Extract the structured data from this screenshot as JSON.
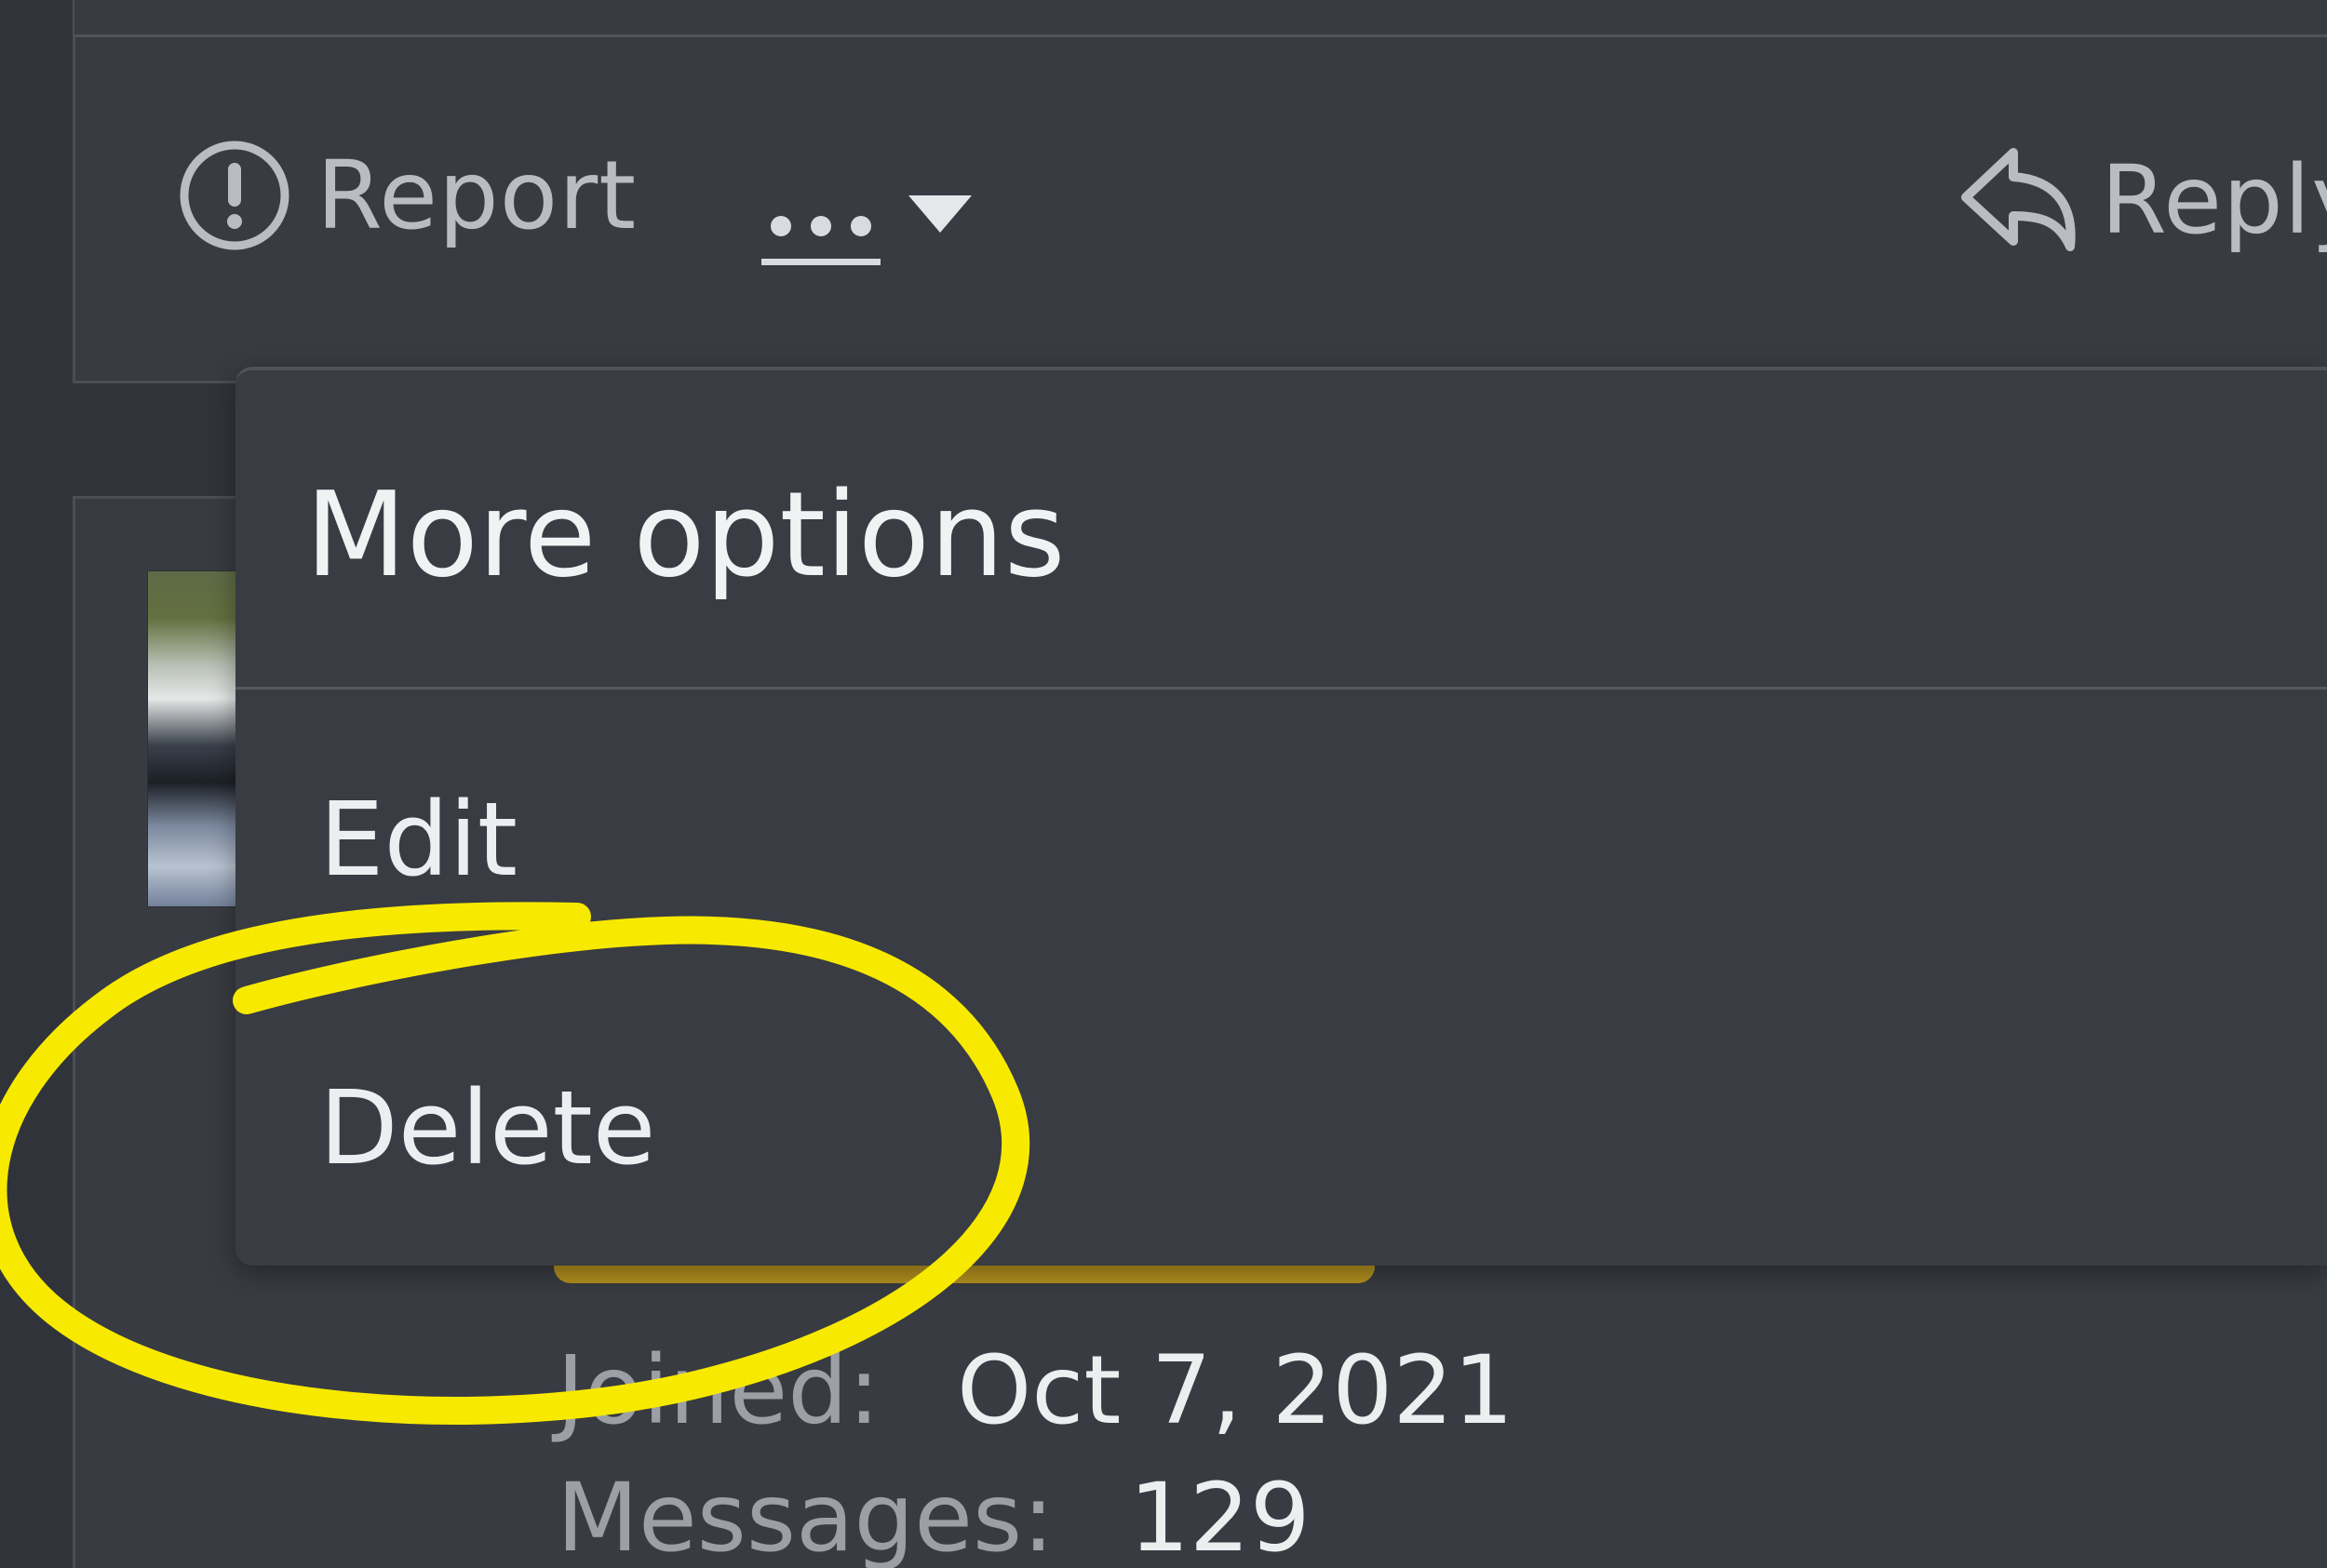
{
  "post_footer": {
    "report_label": "Report",
    "reply_label": "Reply",
    "icons": {
      "report": "exclamation-circle-icon",
      "more": "ellipsis-icon",
      "caret": "caret-down-icon",
      "reply": "reply-arrow-icon"
    }
  },
  "menu": {
    "title": "More options",
    "items": [
      {
        "label": "Edit"
      },
      {
        "label": "Delete"
      }
    ]
  },
  "user_stats": {
    "joined_label": "Joined:",
    "joined_value": "Oct 7, 2021",
    "messages_label": "Messages:",
    "messages_value": "129"
  },
  "colors": {
    "background": "#30343a",
    "panel": "#383b41",
    "menu": "#393c42",
    "highlight": "#f7ea00",
    "accent": "#b28f1f"
  }
}
